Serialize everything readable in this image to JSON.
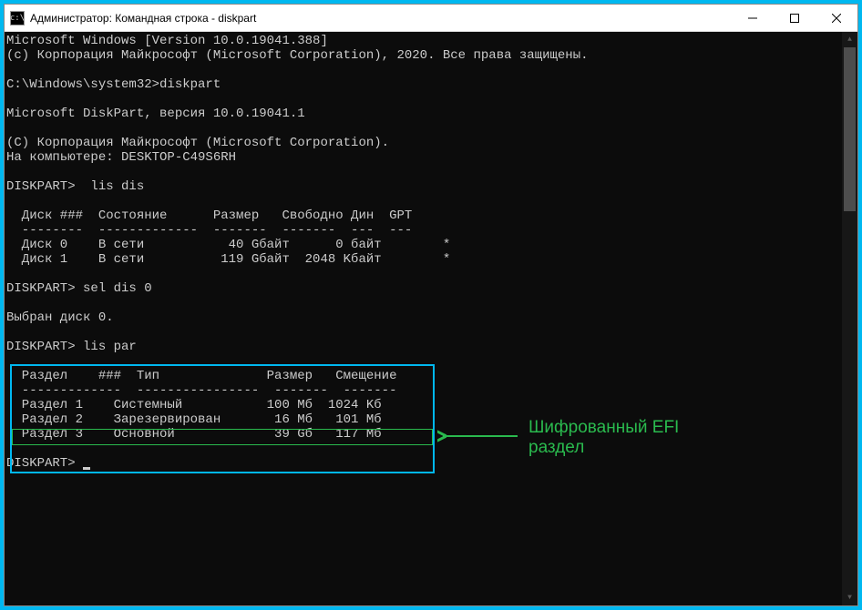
{
  "window": {
    "title": "Администратор: Командная строка - diskpart",
    "icon_label": "cmd"
  },
  "console": {
    "lines": [
      "Microsoft Windows [Version 10.0.19041.388]",
      "(c) Корпорация Майкрософт (Microsoft Corporation), 2020. Все права защищены.",
      "",
      "C:\\Windows\\system32>diskpart",
      "",
      "Microsoft DiskPart, версия 10.0.19041.1",
      "",
      "(C) Корпорация Майкрософт (Microsoft Corporation).",
      "На компьютере: DESKTOP-C49S6RH",
      "",
      "DISKPART>  lis dis",
      "",
      "  Диск ###  Состояние      Размер   Свободно Дин  GPT",
      "  --------  -------------  -------  -------  ---  ---",
      "  Диск 0    В сети           40 Gбайт      0 байт        *",
      "  Диск 1    В сети          119 Gбайт  2048 Kбайт        *",
      "",
      "DISKPART> sel dis 0",
      "",
      "Выбран диск 0.",
      "",
      "DISKPART> lis par",
      "",
      "  Раздел    ###  Тип              Размер   Смещение",
      "  -------------  ----------------  -------  -------",
      "  Раздел 1    Системный           100 Mб  1024 Kб",
      "  Раздел 2    Зарезервирован       16 Mб   101 Mб",
      "  Раздел 3    Основной             39 Gб   117 Mб",
      "",
      "DISKPART> "
    ]
  },
  "annotation": {
    "text": "Шифрованный EFI\nраздел"
  },
  "chart_data": {
    "type": "table",
    "tables": [
      {
        "title": "lis dis",
        "columns": [
          "Диск ###",
          "Состояние",
          "Размер",
          "Свободно",
          "Дин",
          "GPT"
        ],
        "rows": [
          [
            "Диск 0",
            "В сети",
            "40 Gбайт",
            "0 байт",
            "",
            "*"
          ],
          [
            "Диск 1",
            "В сети",
            "119 Gбайт",
            "2048 Kбайт",
            "",
            "*"
          ]
        ]
      },
      {
        "title": "lis par",
        "columns": [
          "Раздел ###",
          "Тип",
          "Размер",
          "Смещение"
        ],
        "rows": [
          [
            "Раздел 1",
            "Системный",
            "100 Mб",
            "1024 Kб"
          ],
          [
            "Раздел 2",
            "Зарезервирован",
            "16 Mб",
            "101 Mб"
          ],
          [
            "Раздел 3",
            "Основной",
            "39 Gб",
            "117 Mб"
          ]
        ]
      }
    ]
  }
}
